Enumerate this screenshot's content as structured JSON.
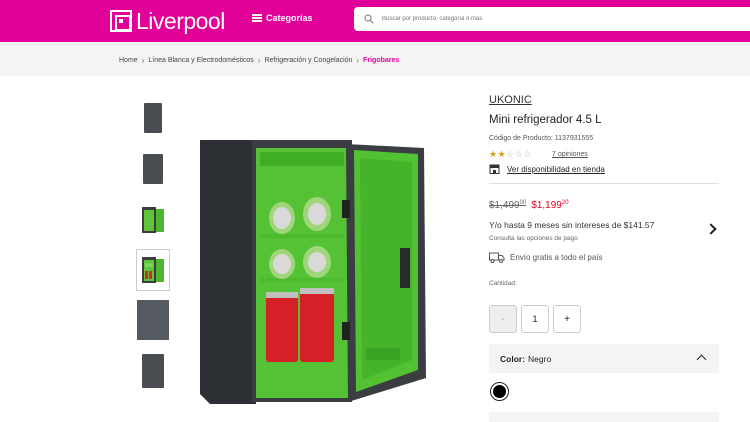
{
  "header": {
    "logo_text": "Liverpool",
    "categories_label": "Categorías",
    "search_placeholder": "Buscar por producto, categoría o más",
    "brand_color": "#e10098"
  },
  "breadcrumb": {
    "items": [
      "Home",
      "Línea Blanca y Electrodomésticos",
      "Refrigeración y Congelación"
    ],
    "current": "Frigobares"
  },
  "gallery": {
    "thumbnails": [
      "fridge-closed-front",
      "fridge-closed-angle",
      "fridge-open-empty",
      "fridge-open-cans",
      "fridge-closed-detail",
      "fridge-closed-side"
    ],
    "selected_index": 3
  },
  "product": {
    "brand": "UKONIC",
    "name": "Mini refrigerador 4.5 L",
    "code": "Código de Producto: 1137931555",
    "rating": 2.5,
    "rating_max": 5,
    "opinions": "7 opiniones",
    "availability": "Ver disponibilidad en tienda",
    "old_price": "$1,499",
    "old_price_cents": "00",
    "new_price": "$1,199",
    "new_price_cents": "20",
    "installments": "Y/o hasta 9 meses sin intereses de $141.57",
    "installments_sub": "Consulta las opciones de pago",
    "shipping": "Envío gratis a todo el país",
    "quantity_label": "Cantidad:",
    "quantity": "1",
    "minus": "-",
    "plus": "+",
    "color_label": "Color:",
    "color_value": "Negro",
    "swatch_color": "#000000",
    "price_color": "#e4001b"
  }
}
